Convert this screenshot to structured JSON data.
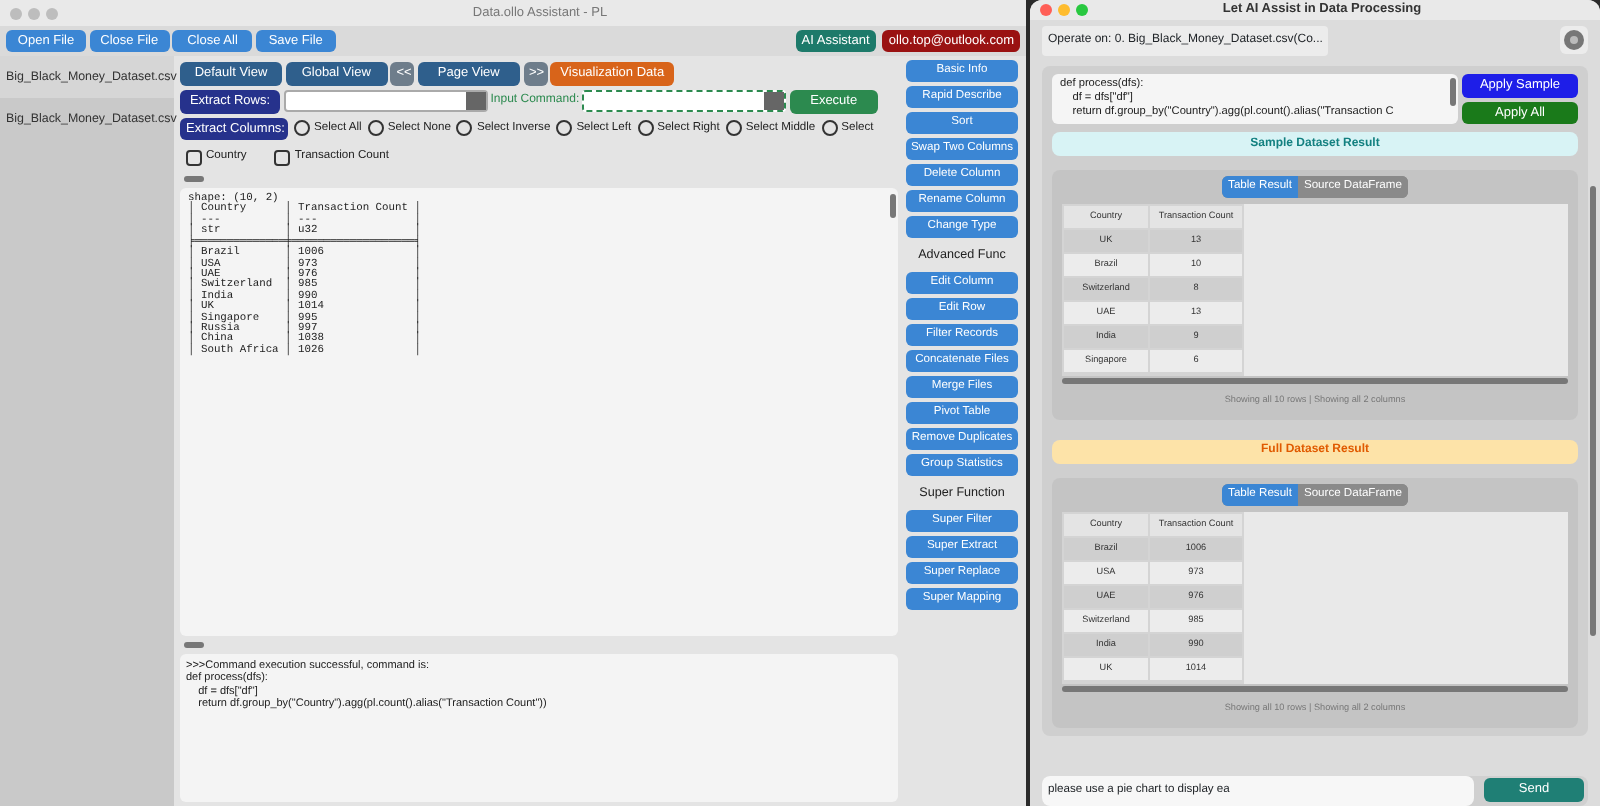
{
  "main_window": {
    "title": "Data.ollo Assistant - PL",
    "toolbar": [
      "Open File",
      "Close File",
      "Close All",
      "Save File"
    ],
    "ai_assistant_button": "AI Assistant",
    "account": "ollo.top@outlook.com",
    "files": [
      {
        "name": "Big_Black_Money_Dataset.csv",
        "selected": true
      },
      {
        "name": "Big_Black_Money_Dataset.csv",
        "selected": false
      }
    ],
    "view_buttons": [
      {
        "label": "Default View",
        "kind": "view"
      },
      {
        "label": "Global View",
        "kind": "view"
      },
      {
        "label": "<<",
        "kind": "nav"
      },
      {
        "label": "Page View",
        "kind": "view"
      },
      {
        "label": ">>",
        "kind": "nav"
      },
      {
        "label": "Visualization Data",
        "kind": "accent"
      }
    ],
    "extract_rows_button": "Extract Rows:",
    "input_command_label": "Input Command:",
    "execute_button": "Execute",
    "extract_columns_button": "Extract Columns:",
    "column_selectors": [
      {
        "label": "Select All",
        "selected": false
      },
      {
        "label": "Select None",
        "selected": false
      },
      {
        "label": "Select Inverse",
        "selected": false
      },
      {
        "label": "Select Left",
        "selected": false
      },
      {
        "label": "Select Right",
        "selected": false
      },
      {
        "label": "Select Middle",
        "selected": false
      },
      {
        "label": "Select",
        "selected": false
      }
    ],
    "columns": [
      {
        "label": "Country",
        "checked": false
      },
      {
        "label": "Transaction Count",
        "checked": false
      }
    ],
    "output_text": "shape: (10, 2)\n│ Country      │ Transaction Count │\n│ ---          │ ---               │\n│ str          │ u32               │\n╞══════════════╪═══════════════════╡\n│ Brazil       │ 1006              │\n│ USA          │ 973               │\n│ UAE          │ 976               │\n│ Switzerland  │ 985               │\n│ India        │ 990               │\n│ UK           │ 1014              │\n│ Singapore    │ 995               │\n│ Russia       │ 997               │\n│ China        │ 1038              │\n│ South Africa │ 1026              │",
    "log_lines": [
      ">>>Command execution successful, command is:",
      "def process(dfs):",
      "    df = dfs[\"df\"]",
      "    return df.group_by(\"Country\").agg(pl.count().alias(\"Transaction Count\"))"
    ],
    "function_panel": [
      {
        "kind": "button",
        "label": "Basic Info"
      },
      {
        "kind": "button",
        "label": "Rapid Describe"
      },
      {
        "kind": "button",
        "label": "Sort"
      },
      {
        "kind": "button",
        "label": "Swap Two Columns"
      },
      {
        "kind": "button",
        "label": "Delete Column"
      },
      {
        "kind": "button",
        "label": "Rename Column"
      },
      {
        "kind": "button",
        "label": "Change Type"
      },
      {
        "kind": "heading",
        "label": "Advanced Func"
      },
      {
        "kind": "button",
        "label": "Edit Column"
      },
      {
        "kind": "button",
        "label": "Edit Row"
      },
      {
        "kind": "button",
        "label": "Filter Records"
      },
      {
        "kind": "button",
        "label": "Concatenate Files"
      },
      {
        "kind": "button",
        "label": "Merge Files"
      },
      {
        "kind": "button",
        "label": "Pivot Table"
      },
      {
        "kind": "button",
        "label": "Remove Duplicates"
      },
      {
        "kind": "button",
        "label": "Group Statistics"
      },
      {
        "kind": "heading",
        "label": "Super Function"
      },
      {
        "kind": "button",
        "label": "Super Filter"
      },
      {
        "kind": "button",
        "label": "Super Extract"
      },
      {
        "kind": "button",
        "label": "Super Replace"
      },
      {
        "kind": "button",
        "label": "Super Mapping"
      }
    ]
  },
  "ai_window": {
    "title": "Let AI Assist in Data Processing",
    "operate_on": "Operate on: 0. Big_Black_Money_Dataset.csv(Co...",
    "code_lines": [
      "def process(dfs):",
      "    df = dfs[\"df\"]",
      "    return df.group_by(\"Country\").agg(pl.count().alias(\"Transaction C"
    ],
    "apply_sample_button": "Apply Sample",
    "apply_all_button": "Apply All",
    "results": [
      {
        "kind": "sample",
        "banner": "Sample Dataset Result",
        "tabs": [
          {
            "label": "Table Result",
            "selected": true
          },
          {
            "label": "Source DataFrame",
            "selected": false
          }
        ],
        "columns": [
          "Country",
          "Transaction Count"
        ],
        "rows": [
          [
            "UK",
            "13"
          ],
          [
            "Brazil",
            "10"
          ],
          [
            "Switzerland",
            "8"
          ],
          [
            "UAE",
            "13"
          ],
          [
            "India",
            "9"
          ],
          [
            "Singapore",
            "6"
          ]
        ],
        "footer": "Showing all 10 rows | Showing all 2 columns"
      },
      {
        "kind": "full",
        "banner": "Full Dataset Result",
        "tabs": [
          {
            "label": "Table Result",
            "selected": true
          },
          {
            "label": "Source DataFrame",
            "selected": false
          }
        ],
        "columns": [
          "Country",
          "Transaction Count"
        ],
        "rows": [
          [
            "Brazil",
            "1006"
          ],
          [
            "USA",
            "973"
          ],
          [
            "UAE",
            "976"
          ],
          [
            "Switzerland",
            "985"
          ],
          [
            "India",
            "990"
          ],
          [
            "UK",
            "1014"
          ]
        ],
        "footer": "Showing all 10 rows | Showing all 2 columns"
      }
    ],
    "prompt": "please use a pie chart to display ea",
    "send_button": "Send"
  }
}
